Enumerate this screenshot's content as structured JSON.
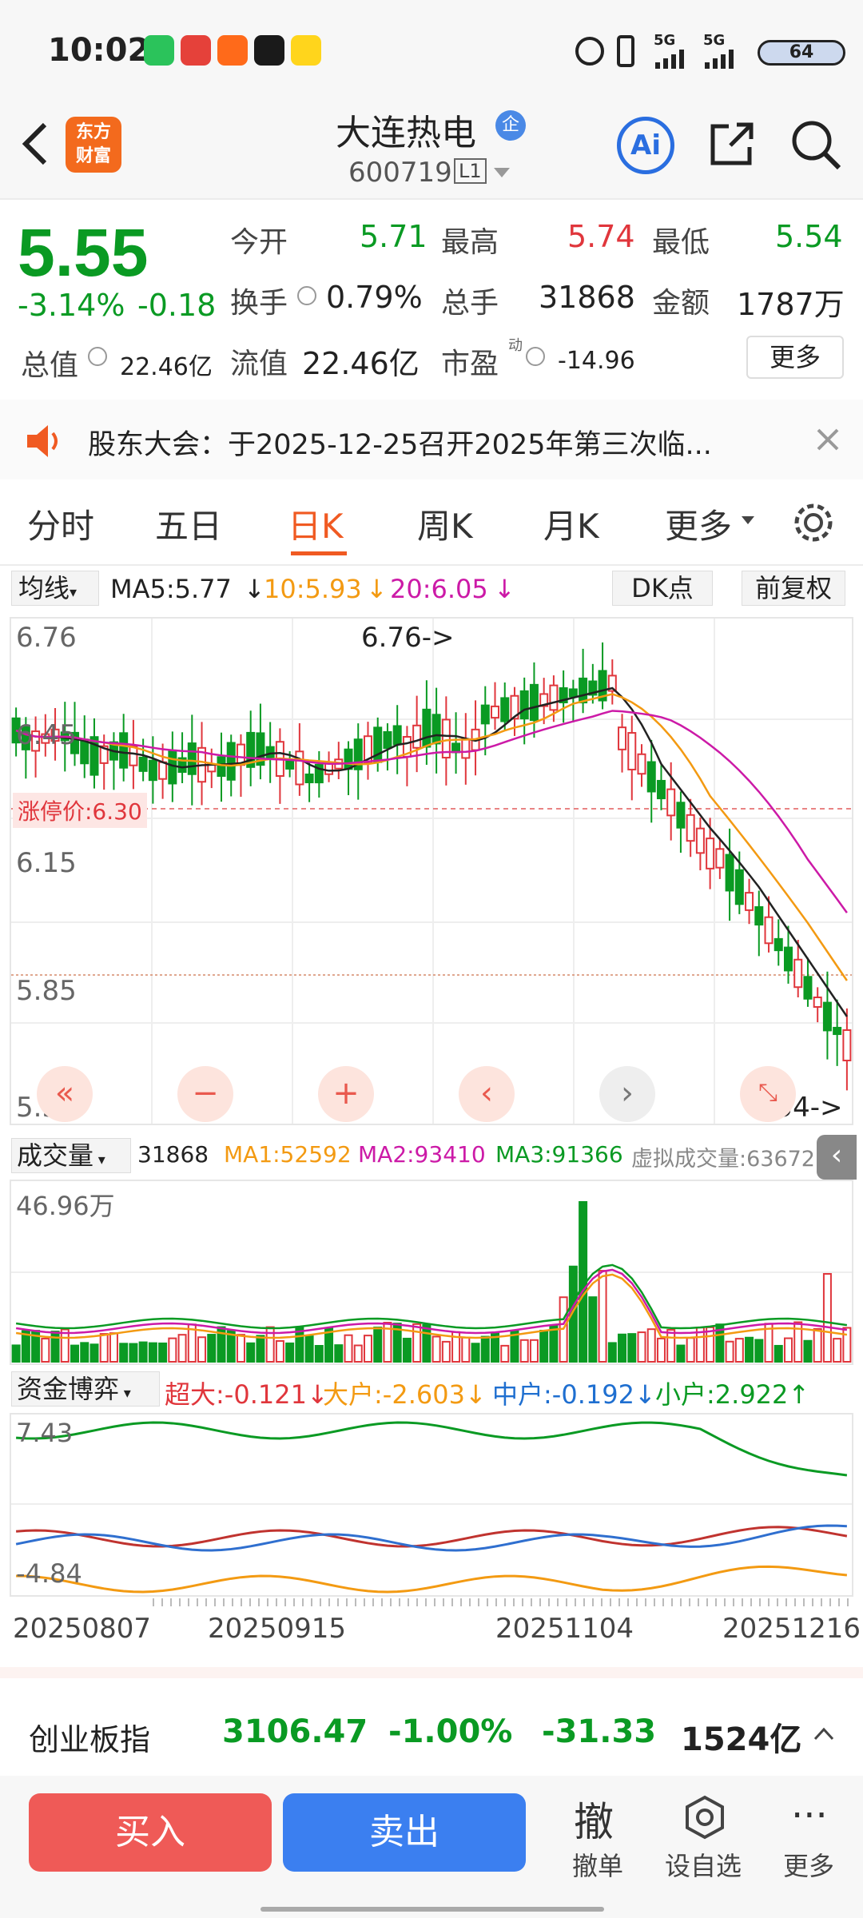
{
  "status": {
    "time": "10:02",
    "net1": "5G",
    "net2": "5G",
    "battery": "64",
    "apps": [
      "wechat",
      "app2",
      "taobao",
      "app4",
      "app5"
    ]
  },
  "header": {
    "logo_line1": "东方",
    "logo_line2": "财富",
    "stock_name": "大连热电",
    "badge": "企",
    "stock_code": "600719",
    "level": "L1"
  },
  "quote": {
    "price": "5.55",
    "pct": "-3.14%",
    "chg": "-0.18",
    "open_label": "今开",
    "open": "5.71",
    "high_label": "最高",
    "high": "5.74",
    "low_label": "最低",
    "low": "5.54",
    "turnover_label": "换手",
    "turnover": "0.79%",
    "volume_label": "总手",
    "volume": "31868",
    "amount_label": "金额",
    "amount": "1787万",
    "mktcap_label": "总值",
    "mktcap": "22.46亿",
    "float_label": "流值",
    "float": "22.46亿",
    "pe_label": "市盈",
    "pe_sup": "动",
    "pe": "-14.96",
    "more": "更多"
  },
  "notice": {
    "text": "股东大会：于2025-12-25召开2025年第三次临..."
  },
  "tabs": [
    "分时",
    "五日",
    "日K",
    "周K",
    "月K",
    "更多"
  ],
  "active_tab": 2,
  "ma": {
    "select": "均线",
    "ma5": "MA5:5.77",
    "ma10": "10:5.93",
    "ma20": "20:6.05",
    "dk": "DK点",
    "fq": "前复权"
  },
  "kline": {
    "high_label": "6.76",
    "y1": "6.45",
    "y2": "6.15",
    "y3": "5.85",
    "low_label": "5.54",
    "high_marker": "6.76->",
    "low_marker": "5.54->",
    "limit": "涨停价:6.30"
  },
  "vol": {
    "select": "成交量",
    "v": "31868",
    "ma1": "MA1:52592",
    "ma2": "MA2:93410",
    "ma3": "MA3:91366",
    "virtual": "虚拟成交量:63672",
    "max": "46.96万"
  },
  "fund": {
    "select": "资金博弈",
    "super": "超大:-0.121",
    "big": "大户:-2.603",
    "mid": "中户:-0.192",
    "small": "小户:2.922",
    "ymax": "7.43",
    "ymin": "-4.84"
  },
  "dates": [
    "20250807",
    "20250915",
    "20251104",
    "20251216"
  ],
  "index": {
    "name": "创业板指",
    "value": "3106.47",
    "pct": "-1.00%",
    "chg": "-31.33",
    "amount": "1524亿"
  },
  "bottom": {
    "buy": "买入",
    "sell": "卖出",
    "cancel_glyph": "撤",
    "cancel": "撤单",
    "watch": "设自选",
    "more": "更多"
  },
  "colors": {
    "up": "#e0363c",
    "down": "#0a9a23",
    "ma5": "#222222",
    "ma10": "#f39a12",
    "ma20": "#cc1aa7",
    "buy": "#ef5a57",
    "sell": "#3b7ff0"
  }
}
